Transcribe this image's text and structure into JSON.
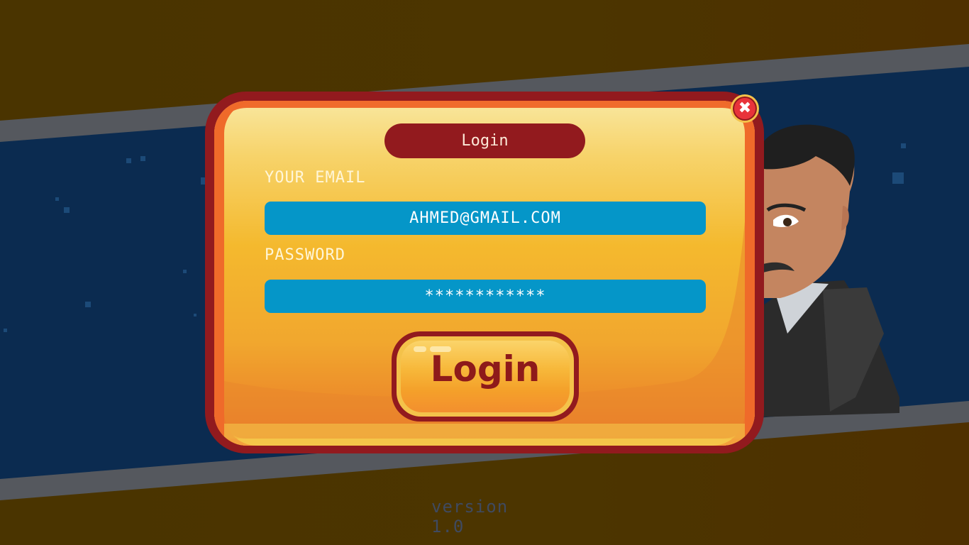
{
  "modal": {
    "title": "Login",
    "email_label": "YOUR EMAIL",
    "email_value": "AHMED@GMAIL.COM",
    "password_label": "PASSWORD",
    "password_value": "************",
    "login_button": "Login",
    "close_glyph": "✖"
  },
  "footer": {
    "version": "version 1.0"
  },
  "icons": {
    "close": "close-icon",
    "character": "character-portrait"
  },
  "colors": {
    "frame": "#921a1e",
    "field": "#0596c8",
    "background": "#4a3400",
    "band_dark": "#0a2a4f"
  }
}
